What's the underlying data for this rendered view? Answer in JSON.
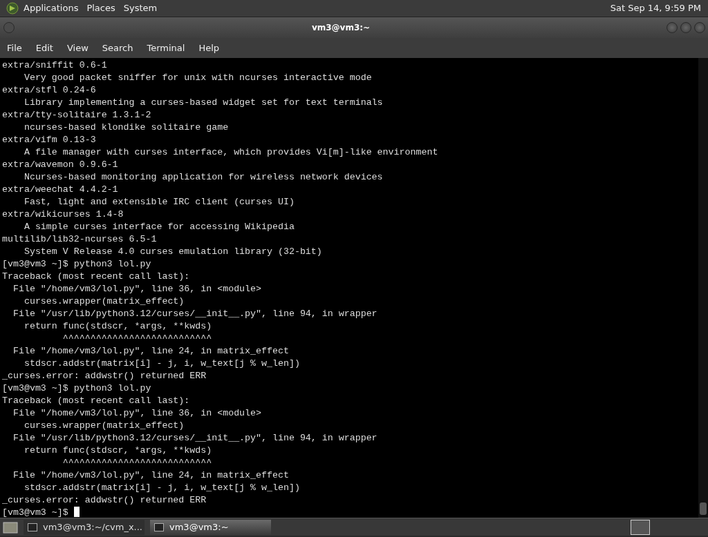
{
  "top_panel": {
    "menus": [
      "Applications",
      "Places",
      "System"
    ],
    "clock": "Sat Sep 14,  9:59 PM"
  },
  "window": {
    "title": "vm3@vm3:~"
  },
  "menu_bar": [
    "File",
    "Edit",
    "View",
    "Search",
    "Terminal",
    "Help"
  ],
  "terminal": {
    "lines": [
      "extra/sniffit 0.6-1",
      "    Very good packet sniffer for unix with ncurses interactive mode",
      "extra/stfl 0.24-6",
      "    Library implementing a curses-based widget set for text terminals",
      "extra/tty-solitaire 1.3.1-2",
      "    ncurses-based klondike solitaire game",
      "extra/vifm 0.13-3",
      "    A file manager with curses interface, which provides Vi[m]-like environment",
      "extra/wavemon 0.9.6-1",
      "    Ncurses-based monitoring application for wireless network devices",
      "extra/weechat 4.4.2-1",
      "    Fast, light and extensible IRC client (curses UI)",
      "extra/wikicurses 1.4-8",
      "    A simple curses interface for accessing Wikipedia",
      "multilib/lib32-ncurses 6.5-1",
      "    System V Release 4.0 curses emulation library (32-bit)",
      "[vm3@vm3 ~]$ python3 lol.py",
      "Traceback (most recent call last):",
      "  File \"/home/vm3/lol.py\", line 36, in <module>",
      "    curses.wrapper(matrix_effect)",
      "  File \"/usr/lib/python3.12/curses/__init__.py\", line 94, in wrapper",
      "    return func(stdscr, *args, **kwds)",
      "           ^^^^^^^^^^^^^^^^^^^^^^^^^^^",
      "  File \"/home/vm3/lol.py\", line 24, in matrix_effect",
      "    stdscr.addstr(matrix[i] - j, i, w_text[j % w_len])",
      "_curses.error: addwstr() returned ERR",
      "[vm3@vm3 ~]$ python3 lol.py",
      "Traceback (most recent call last):",
      "  File \"/home/vm3/lol.py\", line 36, in <module>",
      "    curses.wrapper(matrix_effect)",
      "  File \"/usr/lib/python3.12/curses/__init__.py\", line 94, in wrapper",
      "    return func(stdscr, *args, **kwds)",
      "           ^^^^^^^^^^^^^^^^^^^^^^^^^^^",
      "  File \"/home/vm3/lol.py\", line 24, in matrix_effect",
      "    stdscr.addstr(matrix[i] - j, i, w_text[j % w_len])",
      "_curses.error: addwstr() returned ERR"
    ],
    "prompt": "[vm3@vm3 ~]$"
  },
  "taskbar": [
    {
      "label": "vm3@vm3:~/cvm_x...",
      "selected": false
    },
    {
      "label": "vm3@vm3:~",
      "selected": true
    }
  ]
}
